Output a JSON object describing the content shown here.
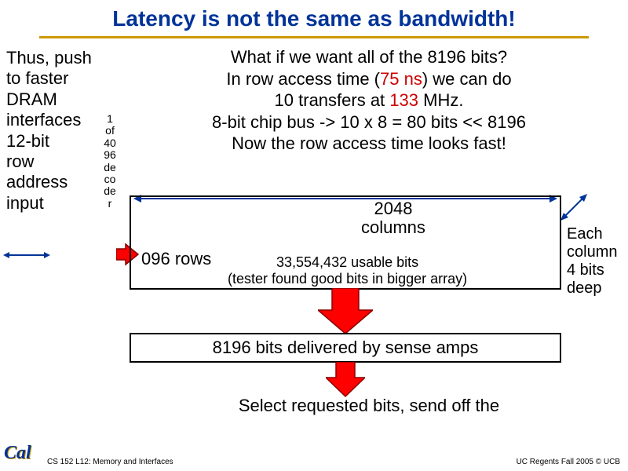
{
  "title": "Latency is not the same as bandwidth!",
  "left_text": {
    "l1": "Thus, push",
    "l2": "to faster",
    "l3": "DRAM",
    "l4": "interfaces",
    "l5": "12-bit",
    "l6": "row",
    "l7": "address",
    "l8": "input"
  },
  "decoder": {
    "d1": "1",
    "d2": "of",
    "d3": "40",
    "d4": "96",
    "d5": "de",
    "d6": "co",
    "d7": "de",
    "d8": "r"
  },
  "question": {
    "q1": "What if we want all of the 8196 bits?",
    "q2_a": "In row access time (",
    "q2_b": "75 ns",
    "q2_c": ") we can do",
    "q3_a": "10 transfers at ",
    "q3_b": "133 ",
    "q3_c": "MHz.",
    "q4": "8-bit chip bus -> 10 x 8 = 80 bits << 8196",
    "q5": "Now the row access time looks fast!"
  },
  "memory": {
    "cols": "2048",
    "cols_label": "columns",
    "rows": "096 rows",
    "usable": "33,554,432 usable bits",
    "tester": "(tester found good bits in bigger array)",
    "each1": "Each",
    "each2": "column",
    "each3": "4 bits",
    "each4": "deep"
  },
  "sense": "8196 bits delivered by sense amps",
  "select": "Select requested bits, send off the",
  "footer": {
    "left": "CS 152 L12: Memory and Interfaces",
    "right": "UC Regents Fall 2005 © UCB"
  },
  "logo": "Cal"
}
